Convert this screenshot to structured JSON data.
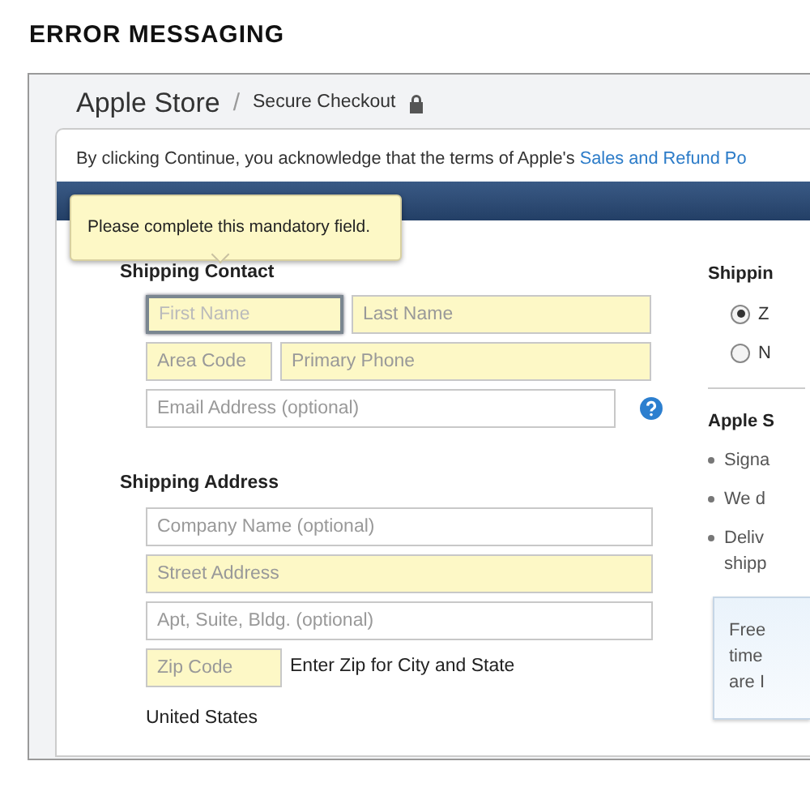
{
  "page_title": "ERROR MESSAGING",
  "store_header": {
    "title": "Apple Store",
    "separator": "/",
    "subtitle": "Secure Checkout"
  },
  "terms": {
    "text": "By clicking Continue, you acknowledge that the terms of Apple's ",
    "link": "Sales and Refund Po"
  },
  "tooltip": {
    "text": "Please complete this mandatory field."
  },
  "contact": {
    "heading": "Shipping Contact",
    "rows": [
      [
        {
          "placeholder": "First Name",
          "required": true,
          "focused": true
        },
        {
          "placeholder": "Last Name",
          "required": true,
          "focused": false
        }
      ],
      [
        {
          "placeholder": "Area Code",
          "required": true,
          "focused": false
        },
        {
          "placeholder": "Primary Phone",
          "required": true,
          "focused": false
        }
      ],
      [
        {
          "placeholder": "Email Address (optional)",
          "required": false,
          "focused": false,
          "help": true
        }
      ]
    ]
  },
  "address": {
    "heading": "Shipping Address",
    "fields": [
      {
        "placeholder": "Company Name (optional)",
        "required": false
      },
      {
        "placeholder": "Street Address",
        "required": true
      },
      {
        "placeholder": "Apt, Suite, Bldg. (optional)",
        "required": false
      }
    ],
    "zip": {
      "placeholder": "Zip Code",
      "required": true
    },
    "zip_hint": "Enter Zip for City and State",
    "country": "United States"
  },
  "side": {
    "heading": "Shippin",
    "options": [
      {
        "label": "Z",
        "selected": true
      },
      {
        "label": "N",
        "selected": false
      }
    ],
    "info_heading": "Apple S",
    "bullets": [
      [
        "Signa"
      ],
      [
        "We d"
      ],
      [
        "Deliv",
        "shipp"
      ]
    ],
    "note": [
      "Free",
      "time",
      "are I"
    ]
  }
}
